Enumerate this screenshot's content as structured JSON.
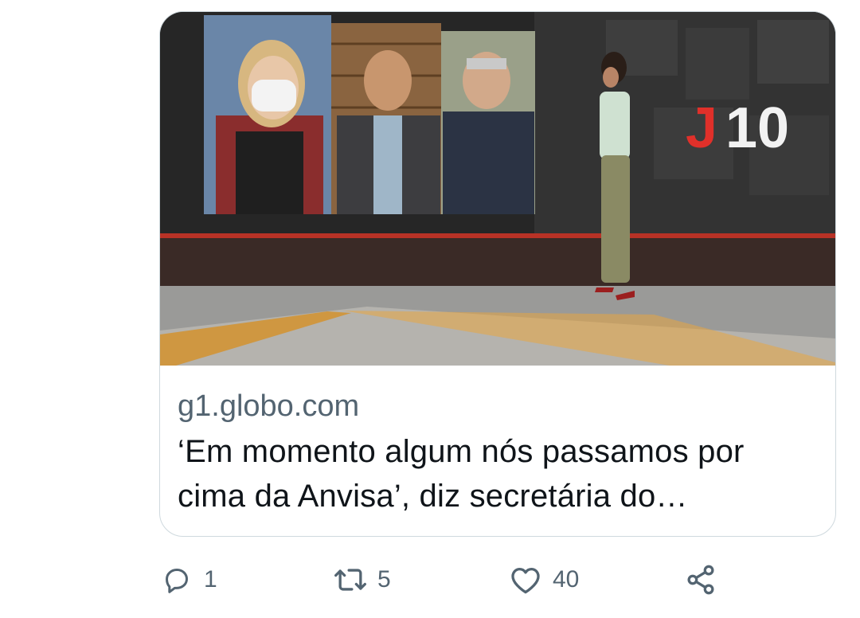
{
  "card": {
    "domain": "g1.globo.com",
    "headline": "‘Em momento algum nós passamos por cima da Anvisa’, diz secretária do…",
    "thumbnail_logo": "J10"
  },
  "actions": {
    "reply": {
      "icon": "reply-icon",
      "count": "1"
    },
    "retweet": {
      "icon": "retweet-icon",
      "count": "5"
    },
    "like": {
      "icon": "heart-icon",
      "count": "40"
    },
    "share": {
      "icon": "share-icon"
    }
  },
  "colors": {
    "text_primary": "#0f1419",
    "text_secondary": "#536471",
    "border": "#cfd9de",
    "logo_red": "#e0302a"
  }
}
